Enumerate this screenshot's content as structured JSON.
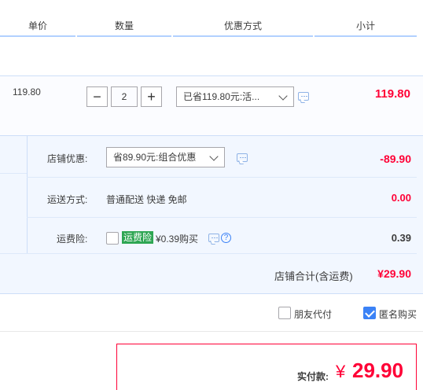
{
  "header": {
    "col_price": "单价",
    "col_qty": "数量",
    "col_discount": "优惠方式",
    "col_subtotal": "小计"
  },
  "item": {
    "price": "119.80",
    "qty_minus": "−",
    "qty_value": "2",
    "qty_plus": "+",
    "discount_selected": "已省119.80元:活...",
    "subtotal": "119.80"
  },
  "shop": {
    "discount_label": "店铺优惠:",
    "discount_selected": "省89.90元:组合优惠",
    "discount_amount": "-89.90",
    "shipping_label": "运送方式:",
    "shipping_value": "普通配送 快递 免邮",
    "shipping_amount": "0.00",
    "insurance_label": "运费险:",
    "insurance_tag": "运费险",
    "insurance_price": "¥0.39购买",
    "insurance_help": "?",
    "insurance_amount": "0.39",
    "total_label": "店铺合计(含运费)",
    "total_amount": "¥29.90"
  },
  "options": {
    "friend_pay_label": "朋友代付",
    "friend_pay_checked": false,
    "anonymous_label": "匿名购买",
    "anonymous_checked": true
  },
  "pay": {
    "label": "实付款:",
    "currency": "¥",
    "amount": "29.90"
  },
  "colors": {
    "accent_red": "#ff0036",
    "header_underline": "#b2d1ff",
    "shop_bg": "#f2f7ff",
    "check_blue": "#3b82f6",
    "tag_green": "#2ea653"
  }
}
